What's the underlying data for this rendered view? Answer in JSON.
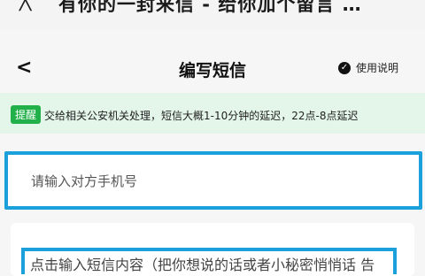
{
  "topbar": {
    "back_glyph": "╳",
    "title": "有你的一封来信 - 给你加个留言 …"
  },
  "header": {
    "back_glyph": "<",
    "title": "编写短信",
    "help_label": "使用说明",
    "help_icon": "check-circle-icon"
  },
  "notice": {
    "tag": "提醒",
    "text": "交给相关公安机关处理，短信大概1-10分钟的延迟，22点-8点延迟"
  },
  "phone": {
    "placeholder": "请输入对方手机号",
    "value": ""
  },
  "content": {
    "placeholder": "点击输入短信内容（把你想说的话或者小秘密悄悄话 告"
  },
  "colors": {
    "accent_blue": "#1ba0dc",
    "notice_green_bg": "#e4f6e9",
    "tag_green": "#22b04b"
  }
}
